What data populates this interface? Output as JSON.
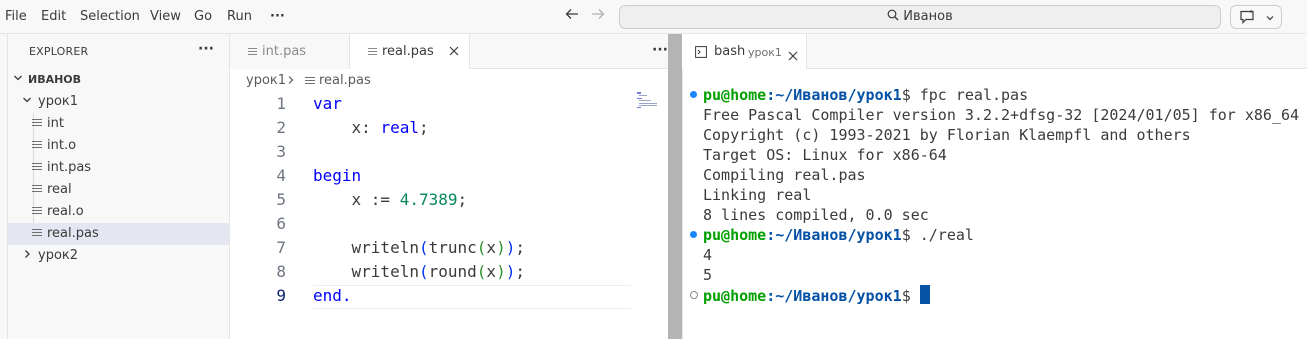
{
  "menu": [
    "File",
    "Edit",
    "Selection",
    "View",
    "Go",
    "Run",
    "···"
  ],
  "search": {
    "text": "Иванов"
  },
  "explorer": {
    "title": "EXPLORER",
    "more": "···",
    "root": "ИВАНОВ",
    "folders": [
      {
        "label": "урок1",
        "expanded": true
      },
      {
        "label": "урок2",
        "expanded": false
      }
    ],
    "files": [
      "int",
      "int.o",
      "int.pas",
      "real",
      "real.o",
      "real.pas"
    ],
    "selected": "real.pas"
  },
  "editor": {
    "tabs": [
      {
        "label": "int.pas",
        "active": false
      },
      {
        "label": "real.pas",
        "active": true
      }
    ],
    "more": "···",
    "breadcrumb": {
      "folder": "урок1",
      "file": "real.pas"
    },
    "line_numbers": [
      "1",
      "2",
      "3",
      "4",
      "5",
      "6",
      "7",
      "8",
      "9"
    ],
    "code": {
      "l1_kw": "var",
      "l2_a": "    x: ",
      "l2_kw": "real",
      "l2_b": ";",
      "l4_kw": "begin",
      "l5_a": "    x := ",
      "l5_num": "4.7389",
      "l5_b": ";",
      "l7_fn": "    writeln",
      "l7_fn2": "trunc",
      "l7_arg": "x",
      "l8_fn": "    writeln",
      "l8_fn2": "round",
      "l8_arg": "x",
      "l9_kw": "end",
      "l9_b": "."
    }
  },
  "terminal": {
    "tab_label": "bash",
    "tab_desc": "урок1",
    "prompt_user": "pu@home",
    "prompt_path": ":~/Иванов/урок1",
    "prompt_sign": "$",
    "cmd1": " fpc real.pas",
    "output1": [
      "Free Pascal Compiler version 3.2.2+dfsg-32 [2024/01/05] for x86_64",
      "Copyright (c) 1993-2021 by Florian Klaempfl and others",
      "Target OS: Linux for x86-64",
      "Compiling real.pas",
      "Linking real",
      "8 lines compiled, 0.0 sec"
    ],
    "cmd2": " ./real",
    "output2": [
      "4",
      "5"
    ]
  }
}
